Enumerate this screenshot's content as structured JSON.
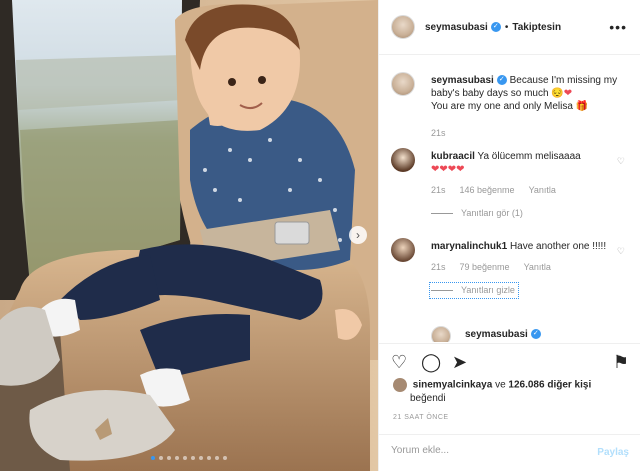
{
  "post": {
    "username": "seymasubasi",
    "follow_separator": "•",
    "follow_state": "Takiptesin",
    "more_icon": "more-horizontal-icon"
  },
  "caption": {
    "username": "seymasubasi",
    "text": "Because I'm missing my baby's baby days so much",
    "text2": "You are my one and only Melisa",
    "time": "21s"
  },
  "comments": [
    {
      "username": "kubraacil",
      "text": "Ya ölücemm melisaaaa",
      "hearts": "❤❤❤❤",
      "time": "21s",
      "likes": "146 beğenme",
      "reply": "Yanıtla",
      "replies_label": "Yanıtları gör (1)"
    },
    {
      "username": "marynalinchuk1",
      "text": "Have another one !!!!!",
      "time": "21s",
      "likes": "79 beğenme",
      "reply": "Yanıtla",
      "replies_label": "Yanıtları gizle"
    },
    {
      "username": "seymasubasi"
    }
  ],
  "likes_line": {
    "user": "sinemyalcinkaya",
    "connector": "ve",
    "count": "126.086 diğer kişi",
    "suffix": "beğendi"
  },
  "time_ago": "21 SAAT ÖNCE",
  "add_comment": {
    "placeholder": "Yorum ekle...",
    "post_label": "Paylaş"
  },
  "colors": {
    "accent": "#3897f0",
    "heart": "#ed4956",
    "muted": "#999999"
  }
}
